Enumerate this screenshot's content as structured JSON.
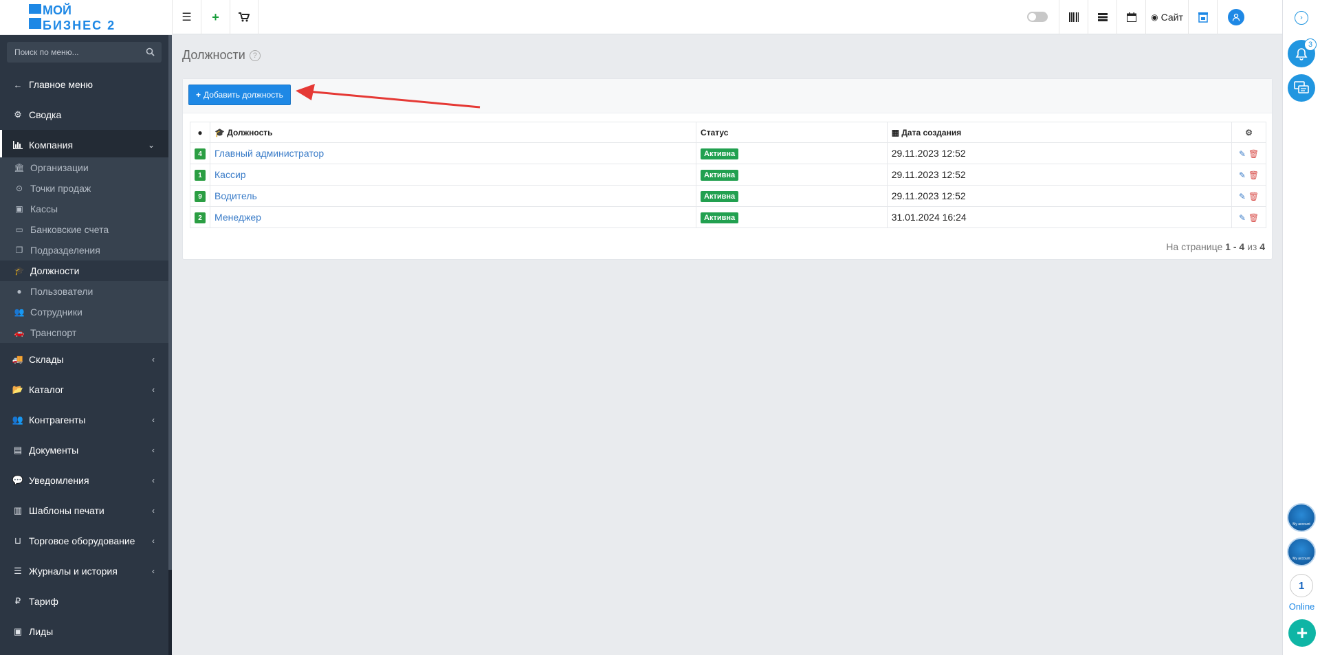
{
  "logo": {
    "line1": "МОЙ",
    "line2": "БИЗНЕС 2"
  },
  "topbar": {
    "site_label": "Сайт"
  },
  "sidebar": {
    "search_placeholder": "Поиск по меню...",
    "items": [
      {
        "label": "Главное меню",
        "icon": "arrow-left-icon"
      },
      {
        "label": "Сводка",
        "icon": "gear-icon"
      },
      {
        "label": "Компания",
        "icon": "bar-chart-icon"
      },
      {
        "label": "Склады",
        "icon": "truck-icon"
      },
      {
        "label": "Каталог",
        "icon": "folder-open-icon"
      },
      {
        "label": "Контрагенты",
        "icon": "users-icon"
      },
      {
        "label": "Документы",
        "icon": "document-icon"
      },
      {
        "label": "Уведомления",
        "icon": "chat-icon"
      },
      {
        "label": "Шаблоны печати",
        "icon": "file-icon"
      },
      {
        "label": "Торговое оборудование",
        "icon": "inbox-icon"
      },
      {
        "label": "Журналы и история",
        "icon": "list-icon"
      },
      {
        "label": "Тариф",
        "icon": "ruble-icon"
      },
      {
        "label": "Лиды",
        "icon": "contact-icon"
      }
    ],
    "submenu": [
      {
        "label": "Организации",
        "icon": "bank-icon"
      },
      {
        "label": "Точки продаж",
        "icon": "target-icon"
      },
      {
        "label": "Кассы",
        "icon": "money-icon"
      },
      {
        "label": "Банковские счета",
        "icon": "credit-card-icon"
      },
      {
        "label": "Подразделения",
        "icon": "copy-icon"
      },
      {
        "label": "Должности",
        "icon": "graduation-cap-icon"
      },
      {
        "label": "Пользователи",
        "icon": "user-icon"
      },
      {
        "label": "Сотрудники",
        "icon": "users-icon"
      },
      {
        "label": "Транспорт",
        "icon": "car-icon"
      }
    ]
  },
  "main": {
    "title": "Должности",
    "add_button": "Добавить должность",
    "table": {
      "headers": {
        "position": "Должность",
        "status": "Статус",
        "created": "Дата создания"
      },
      "rows": [
        {
          "count": "4",
          "name": "Главный администратор",
          "status": "Активна",
          "created": "29.11.2023 12:52"
        },
        {
          "count": "1",
          "name": "Кассир",
          "status": "Активна",
          "created": "29.11.2023 12:52"
        },
        {
          "count": "9",
          "name": "Водитель",
          "status": "Активна",
          "created": "29.11.2023 12:52"
        },
        {
          "count": "2",
          "name": "Менеджер",
          "status": "Активна",
          "created": "31.01.2024 16:24"
        }
      ]
    },
    "pager": {
      "prefix": "На странице",
      "range": "1 - 4",
      "of": "из",
      "total": "4"
    }
  },
  "rail": {
    "notif_count": "3",
    "account_label": "My account",
    "online_count": "1",
    "online_label": "Online"
  },
  "colors": {
    "accent": "#1e88e5",
    "sidebar": "#2c3643",
    "success": "#22a050",
    "danger": "#d9534f"
  }
}
